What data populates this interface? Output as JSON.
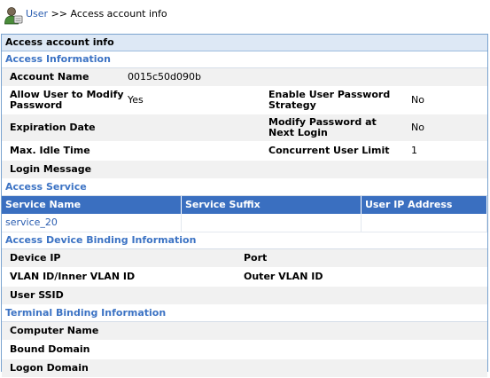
{
  "breadcrumb": {
    "link": "User",
    "separator": ">>",
    "current": "Access account info"
  },
  "panel": {
    "title": "Access account info"
  },
  "access_information": {
    "heading": "Access Information",
    "account_name_label": "Account Name",
    "account_name_value": "0015c50d090b",
    "allow_modify_label": "Allow User to Modify Password",
    "allow_modify_value": "Yes",
    "enable_strategy_label": "Enable User Password Strategy",
    "enable_strategy_value": "No",
    "expiration_label": "Expiration Date",
    "expiration_value": "",
    "modify_next_label": "Modify Password at Next Login",
    "modify_next_value": "No",
    "idle_label": "Max. Idle Time",
    "idle_value": "",
    "concurrent_label": "Concurrent User Limit",
    "concurrent_value": "1",
    "login_message_label": "Login Message",
    "login_message_value": ""
  },
  "access_service": {
    "heading": "Access Service",
    "columns": [
      "Service Name",
      "Service Suffix",
      "User IP Address"
    ],
    "rows": [
      {
        "name": "service_20",
        "suffix": "",
        "ip": ""
      }
    ]
  },
  "device_binding": {
    "heading": "Access Device Binding Information",
    "device_ip_label": "Device IP",
    "port_label": "Port",
    "vlan_label": "VLAN ID/Inner VLAN ID",
    "outer_vlan_label": "Outer VLAN ID",
    "ssid_label": "User SSID"
  },
  "terminal_binding": {
    "heading": "Terminal Binding Information",
    "computer_name_label": "Computer Name",
    "bound_domain_label": "Bound Domain",
    "logon_domain_label": "Logon Domain"
  }
}
